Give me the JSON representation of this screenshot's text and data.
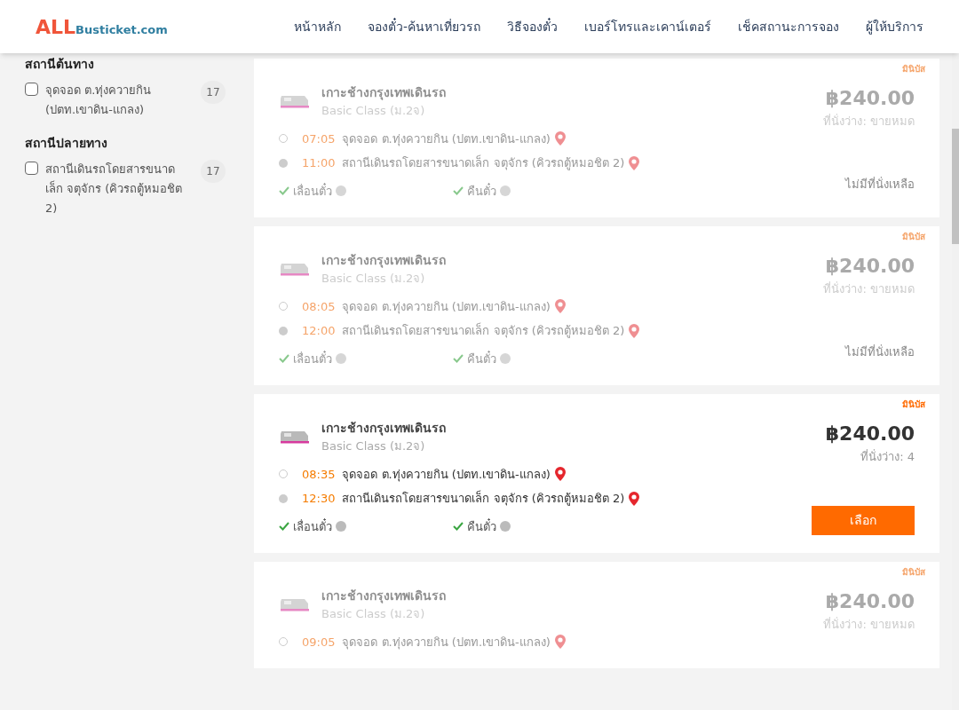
{
  "header": {
    "logo": {
      "brand": "ALL",
      "domain": "Busticket.com"
    },
    "nav": [
      {
        "label": "หน้าหลัก"
      },
      {
        "label": "จองตั๋ว-ค้นหาเที่ยวรถ"
      },
      {
        "label": "วิธีจองตั๋ว"
      },
      {
        "label": "เบอร์โทรและเคาน์เตอร์"
      },
      {
        "label": "เช็คสถานะการจอง"
      },
      {
        "label": "ผู้ให้บริการ"
      }
    ]
  },
  "filters": [
    {
      "title": "สถานีต้นทาง",
      "options": [
        {
          "label": "จุดจอด ต.ทุ่งควายกิน (ปตท.เขาดิน-แกลง)",
          "count": "17",
          "checked": false
        }
      ]
    },
    {
      "title": "สถานีปลายทาง",
      "options": [
        {
          "label": "สถานีเดินรถโดยสารขนาดเล็ก จตุจักร (คิวรถตู้หมอชิต 2)",
          "count": "17",
          "checked": false
        }
      ]
    }
  ],
  "trips": [
    {
      "available": false,
      "vehicle": "มินิบัส",
      "operator": "เกาะช้างกรุงเทพเดินรถ",
      "class": "Basic Class (ม.2จ)",
      "price": "฿240.00",
      "seats": "ที่นั่งว่าง: ขายหมด",
      "stops": [
        {
          "time": "07:05",
          "place": "จุดจอด ต.ทุ่งควายกิน (ปตท.เขาดิน-แกลง)"
        },
        {
          "time": "11:00",
          "place": "สถานีเดินรถโดยสารขนาดเล็ก จตุจักร (คิวรถตู้หมอชิต 2)"
        }
      ],
      "features": [
        "เลื่อนตั๋ว",
        "คืนตั๋ว"
      ],
      "status": "ไม่มีที่นั่งเหลือ"
    },
    {
      "available": false,
      "vehicle": "มินิบัส",
      "operator": "เกาะช้างกรุงเทพเดินรถ",
      "class": "Basic Class (ม.2จ)",
      "price": "฿240.00",
      "seats": "ที่นั่งว่าง: ขายหมด",
      "stops": [
        {
          "time": "08:05",
          "place": "จุดจอด ต.ทุ่งควายกิน (ปตท.เขาดิน-แกลง)"
        },
        {
          "time": "12:00",
          "place": "สถานีเดินรถโดยสารขนาดเล็ก จตุจักร (คิวรถตู้หมอชิต 2)"
        }
      ],
      "features": [
        "เลื่อนตั๋ว",
        "คืนตั๋ว"
      ],
      "status": "ไม่มีที่นั่งเหลือ"
    },
    {
      "available": true,
      "vehicle": "มินิบัส",
      "operator": "เกาะช้างกรุงเทพเดินรถ",
      "class": "Basic Class (ม.2จ)",
      "price": "฿240.00",
      "seats": "ที่นั่งว่าง: 4",
      "stops": [
        {
          "time": "08:35",
          "place": "จุดจอด ต.ทุ่งควายกิน (ปตท.เขาดิน-แกลง)"
        },
        {
          "time": "12:30",
          "place": "สถานีเดินรถโดยสารขนาดเล็ก จตุจักร (คิวรถตู้หมอชิต 2)"
        }
      ],
      "features": [
        "เลื่อนตั๋ว",
        "คืนตั๋ว"
      ],
      "status": "เลือก"
    },
    {
      "available": false,
      "vehicle": "มินิบัส",
      "operator": "เกาะช้างกรุงเทพเดินรถ",
      "class": "Basic Class (ม.2จ)",
      "price": "฿240.00",
      "seats": "ที่นั่งว่าง: ขายหมด",
      "stops": [
        {
          "time": "09:05",
          "place": "จุดจอด ต.ทุ่งควายกิน (ปตท.เขาดิน-แกลง)"
        }
      ]
    }
  ]
}
